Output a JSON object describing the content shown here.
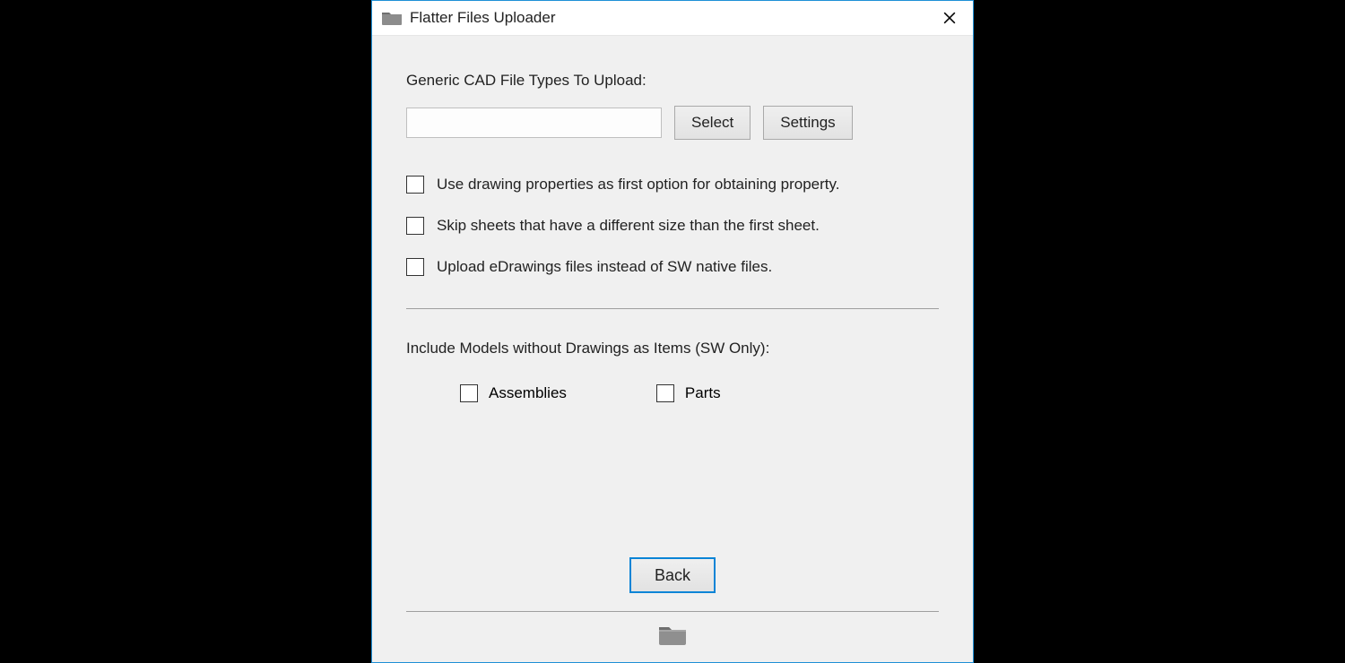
{
  "window": {
    "title": "Flatter Files Uploader"
  },
  "section": {
    "label": "Generic CAD File Types To Upload:",
    "inputValue": "",
    "selectLabel": "Select",
    "settingsLabel": "Settings"
  },
  "checks": {
    "useDrawingProps": "Use drawing properties as first option for obtaining property.",
    "skipSheets": "Skip sheets that have a different size than the first sheet.",
    "uploadEdrawings": "Upload eDrawings files instead of SW native files."
  },
  "models": {
    "label": "Include Models without Drawings as Items (SW Only):",
    "assemblies": "Assemblies",
    "parts": "Parts"
  },
  "footer": {
    "backLabel": "Back"
  }
}
